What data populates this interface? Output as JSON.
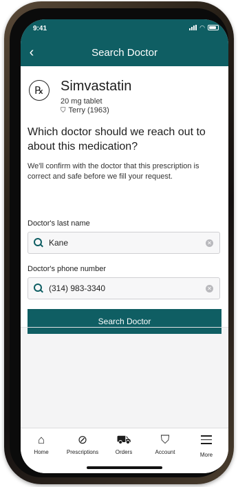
{
  "status_bar": {
    "time": "9:41",
    "wifi_icon": "wifi-icon",
    "battery_icon": "battery-icon"
  },
  "header": {
    "title": "Search Doctor",
    "back_icon": "chevron-left-icon"
  },
  "medication": {
    "name": "Simvastatin",
    "dose": "20 mg tablet",
    "patient": "Terry (1963)",
    "icon": "rx-icon"
  },
  "prompt": {
    "question": "Which doctor should we reach out to about this medication?",
    "explanation": "We'll confirm with the doctor that this prescription is correct and safe before we fill your request."
  },
  "form": {
    "last_name_label": "Doctor's last name",
    "last_name_value": "Kane",
    "phone_label": "Doctor's phone number",
    "phone_value": "(314) 983-3340",
    "submit_label": "Search Doctor"
  },
  "tabs": [
    {
      "label": "Home",
      "icon": "home-icon"
    },
    {
      "label": "Prescriptions",
      "icon": "pill-icon"
    },
    {
      "label": "Orders",
      "icon": "truck-icon"
    },
    {
      "label": "Account",
      "icon": "person-icon"
    },
    {
      "label": "More",
      "icon": "menu-icon"
    }
  ],
  "colors": {
    "brand": "#0f5e63",
    "background": "#f4f4f5"
  }
}
